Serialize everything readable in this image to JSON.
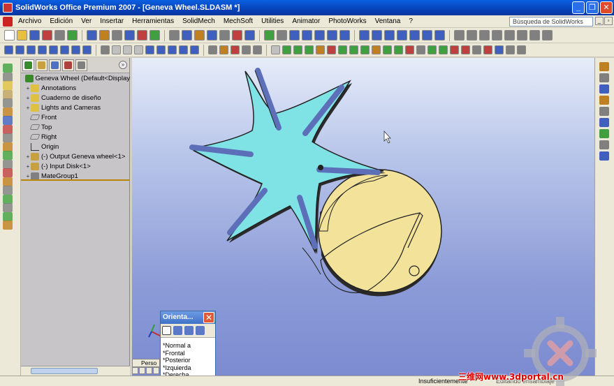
{
  "window": {
    "title": "SolidWorks Office Premium 2007 - [Geneva Wheel.SLDASM *]"
  },
  "menu": [
    "Archivo",
    "Edición",
    "Ver",
    "Insertar",
    "Herramientas",
    "SolidMech",
    "MechSoft",
    "Utilities",
    "Animator",
    "PhotoWorks",
    "Ventana",
    "?"
  ],
  "search": {
    "placeholder": "Búsqueda de SolidWorks"
  },
  "feature_tree": {
    "items": [
      {
        "label": "Geneva Wheel  (Default<Display",
        "icon": "assembly-icon",
        "exp": ""
      },
      {
        "label": "Annotations",
        "icon": "annotations-icon",
        "exp": "+"
      },
      {
        "label": "Cuaderno de diseño",
        "icon": "design-binder-icon",
        "exp": "+"
      },
      {
        "label": "Lights and Cameras",
        "icon": "lights-icon",
        "exp": "+"
      },
      {
        "label": "Front",
        "icon": "plane-icon",
        "exp": ""
      },
      {
        "label": "Top",
        "icon": "plane-icon",
        "exp": ""
      },
      {
        "label": "Right",
        "icon": "plane-icon",
        "exp": ""
      },
      {
        "label": "Origin",
        "icon": "origin-icon",
        "exp": ""
      },
      {
        "label": "(-) Output Geneva wheel<1>",
        "icon": "part-icon",
        "exp": "+"
      },
      {
        "label": "(-) Input Disk<1>",
        "icon": "part-icon",
        "exp": "+"
      },
      {
        "label": "MateGroup1",
        "icon": "mates-icon",
        "exp": "+"
      }
    ]
  },
  "orientation_dialog": {
    "title": "Orienta...",
    "items": [
      "*Normal a",
      "*Frontal",
      "*Posterior",
      "*Izquierda",
      "*Derecha"
    ]
  },
  "bottom_tab": {
    "label": "Perso"
  },
  "status": {
    "left": "Insuficientemente",
    "right": "Editando ensamblaje"
  },
  "watermark": {
    "text": "三维网www.3dportal.cn"
  },
  "colors": {
    "geneva_wheel": "#7fe3e6",
    "input_disk": "#f3e39a",
    "viewport_top": "#e6ecf9",
    "viewport_bottom": "#7c8bd0",
    "titlebar": "#0842b8"
  }
}
